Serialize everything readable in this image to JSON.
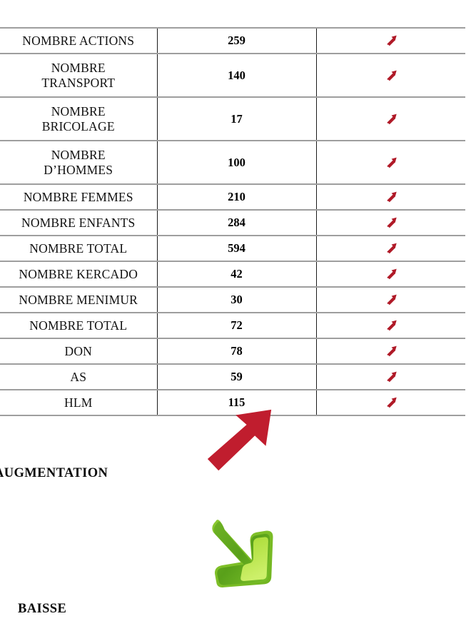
{
  "document": {
    "type": "statistics-table",
    "trend_icon_color": "#b01a28",
    "rule_color": "#9e9e9e"
  },
  "table": {
    "rows": [
      {
        "label_lines": [
          "NOMBRE ACTIONS"
        ],
        "value": "259",
        "trend": "arrow-up-right-icon"
      },
      {
        "label_lines": [
          "NOMBRE",
          "TRANSPORT"
        ],
        "value": "140",
        "trend": "arrow-up-right-icon"
      },
      {
        "label_lines": [
          "NOMBRE",
          "BRICOLAGE"
        ],
        "value": "17",
        "trend": "arrow-up-right-icon"
      },
      {
        "label_lines": [
          "NOMBRE",
          "D’HOMMES"
        ],
        "value": "100",
        "trend": "arrow-up-right-icon"
      },
      {
        "label_lines": [
          "NOMBRE FEMMES"
        ],
        "value": "210",
        "trend": "arrow-up-right-icon"
      },
      {
        "label_lines": [
          "NOMBRE ENFANTS"
        ],
        "value": "284",
        "trend": "arrow-up-right-icon"
      },
      {
        "label_lines": [
          "NOMBRE TOTAL"
        ],
        "value": "594",
        "trend": "arrow-up-right-icon"
      },
      {
        "label_lines": [
          "NOMBRE KERCADO"
        ],
        "value": "42",
        "trend": "arrow-up-right-icon"
      },
      {
        "label_lines": [
          "NOMBRE MENIMUR"
        ],
        "value": "30",
        "trend": "arrow-up-right-icon"
      },
      {
        "label_lines": [
          "NOMBRE TOTAL"
        ],
        "value": "72",
        "trend": "arrow-up-right-icon"
      },
      {
        "label_lines": [
          "DON"
        ],
        "value": "78",
        "trend": "arrow-up-right-icon"
      },
      {
        "label_lines": [
          "AS"
        ],
        "value": "59",
        "trend": "arrow-up-right-icon"
      },
      {
        "label_lines": [
          "HLM"
        ],
        "value": "115",
        "trend": "arrow-up-right-icon"
      }
    ]
  },
  "legend": {
    "increase": {
      "label": "AUGMENTATION",
      "icon": "arrow-up-right-large-icon",
      "color": "#c01d2e"
    },
    "decrease": {
      "label": "BAISSE",
      "icon": "arrow-down-right-large-icon",
      "color_dark": "#5a9e1c",
      "color_light": "#b5e03c"
    }
  }
}
